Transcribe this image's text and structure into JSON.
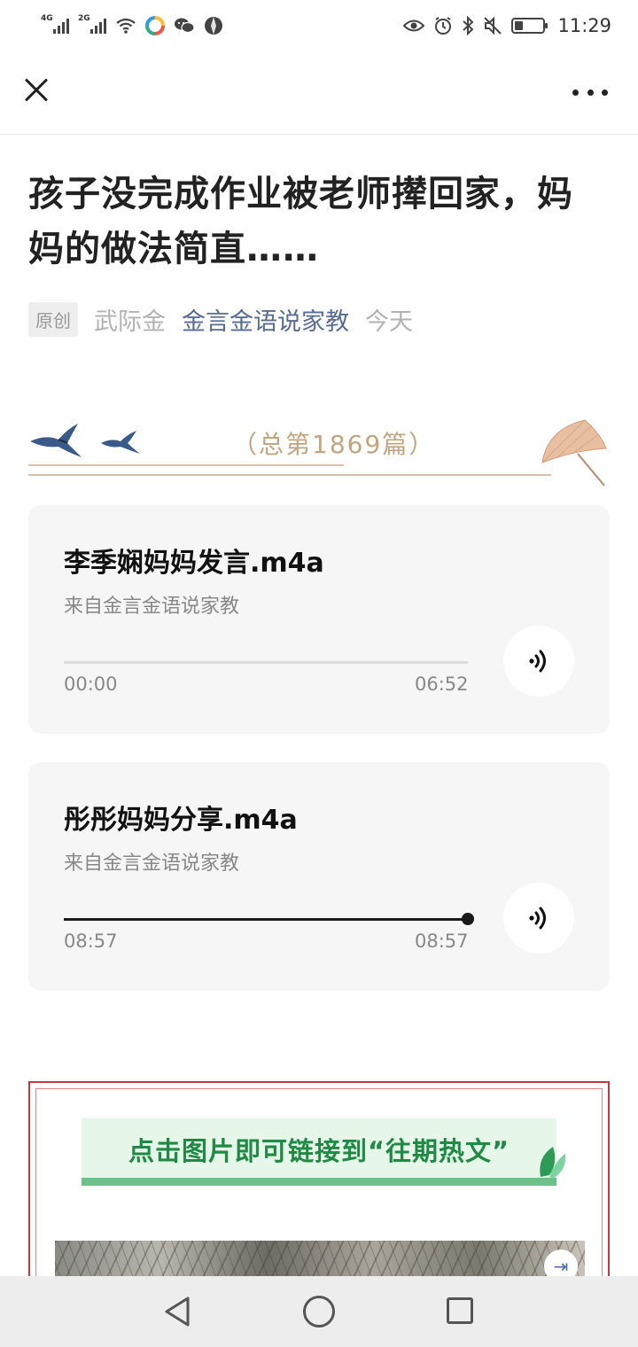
{
  "status_bar": {
    "network1": "4G",
    "network2": "2G",
    "time": "11:29",
    "battery_level": 0.3
  },
  "nav": {
    "close_icon": "close-icon",
    "more_icon": "more-icon"
  },
  "article": {
    "title": "孩子没完成作业被老师撵回家，妈妈的做法简直……",
    "badge": "原创",
    "author": "武际金",
    "account": "金言金语说家教",
    "date": "今天"
  },
  "banner": {
    "count_text": "（总第1869篇）"
  },
  "audio": [
    {
      "title": "李季娴妈妈发言.m4a",
      "source": "来自金言金语说家教",
      "current": "00:00",
      "total": "06:52",
      "progress": 0.0
    },
    {
      "title": "彤彤妈妈分享.m4a",
      "source": "来自金言金语说家教",
      "current": "08:57",
      "total": "08:57",
      "progress": 1.0
    }
  ],
  "hot": {
    "banner_text": "点击图片即可链接到“往期热文”"
  },
  "colors": {
    "link_blue": "#576b95",
    "accent_green": "#1e8a44",
    "frame_red": "#c0393b",
    "decor_gold": "#c2a47e"
  }
}
